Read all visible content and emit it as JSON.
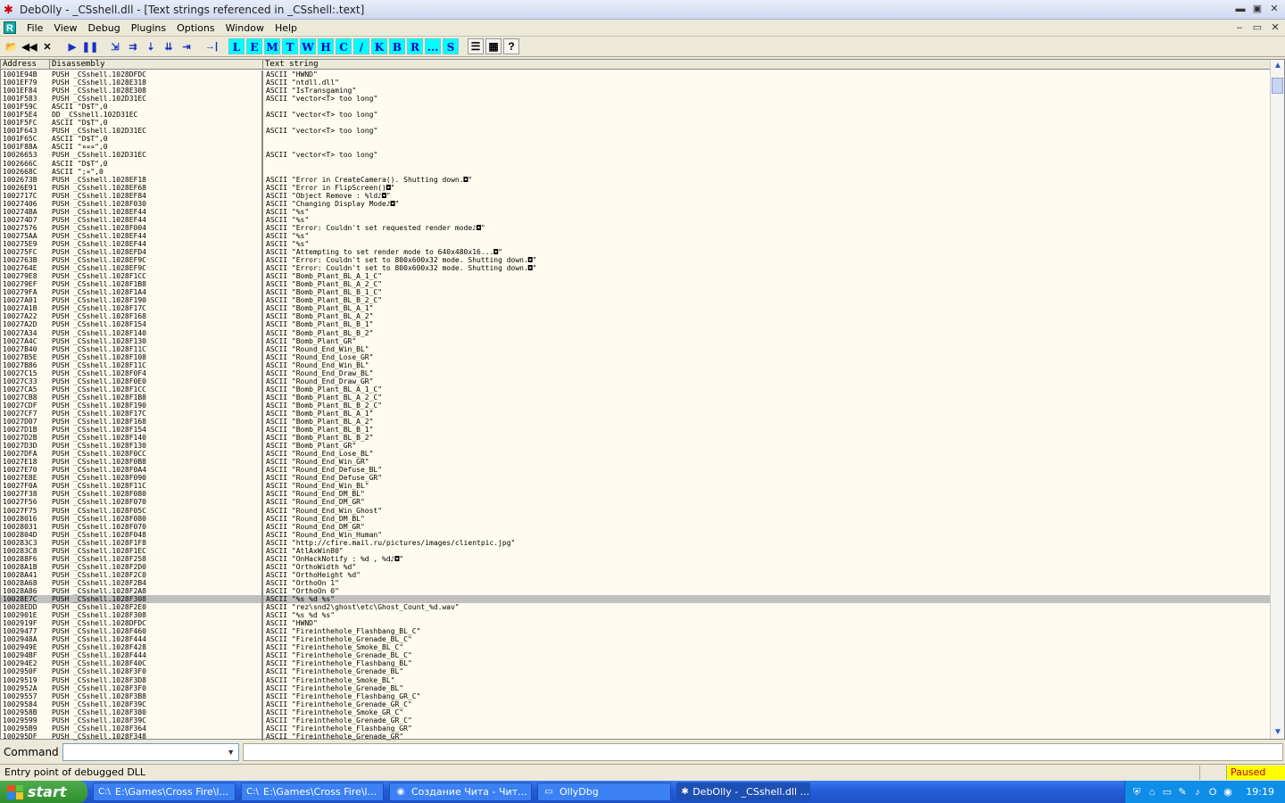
{
  "window": {
    "title": "DebOlly - _CSshell.dll - [Text strings referenced in _CSshell:.text]",
    "controls": [
      "▬",
      "▣",
      "✕"
    ]
  },
  "menu": {
    "logo": "R",
    "items": [
      "File",
      "View",
      "Debug",
      "Plugins",
      "Options",
      "Window",
      "Help"
    ],
    "mdi_controls": [
      "–",
      "▭",
      "✕"
    ]
  },
  "toolbar": {
    "buttons": [
      {
        "icon": "open-icon",
        "glyph": "📂"
      },
      {
        "icon": "rewind-icon",
        "glyph": "◀◀"
      },
      {
        "icon": "close-icon",
        "glyph": "✕"
      },
      {
        "icon": "run-icon",
        "glyph": "▶"
      },
      {
        "icon": "pause-icon",
        "glyph": "❚❚"
      },
      {
        "icon": "step-into-icon",
        "glyph": "⇲"
      },
      {
        "icon": "step-over-icon",
        "glyph": "⇉"
      },
      {
        "icon": "trace-into-icon",
        "glyph": "⇣"
      },
      {
        "icon": "trace-over-icon",
        "glyph": "⇊"
      },
      {
        "icon": "execute-till-return-icon",
        "glyph": "⇥"
      },
      {
        "icon": "goto-icon",
        "glyph": "→|"
      }
    ],
    "letters": [
      "L",
      "E",
      "M",
      "T",
      "W",
      "H",
      "C",
      "/",
      "K",
      "B",
      "R",
      "...",
      "S"
    ],
    "extras": [
      {
        "icon": "list-icon",
        "glyph": "☰"
      },
      {
        "icon": "grid-icon",
        "glyph": "▦"
      },
      {
        "icon": "help-icon",
        "glyph": "?"
      }
    ]
  },
  "grid": {
    "headers": [
      "Address",
      "Disassembly",
      "Text string"
    ],
    "selected_index": 65,
    "rows": [
      [
        "1001E94B",
        "PUSH _CSshell.1028DFDC",
        "ASCII \"HWND\""
      ],
      [
        "1001EF79",
        "PUSH _CSshell.1028E318",
        "ASCII \"ntdll.dll\""
      ],
      [
        "1001EF84",
        "PUSH _CSshell.1028E308",
        "ASCII \"IsTransgaming\""
      ],
      [
        "1001F583",
        "PUSH _CSshell.102D31EC",
        "ASCII \"vector<T> too long\""
      ],
      [
        "1001F59C",
        "ASCII \"D$T\",0",
        ""
      ],
      [
        "1001F5E4",
        "DD _CSshell.102D31EC",
        "ASCII \"vector<T> too long\""
      ],
      [
        "1001F5FC",
        "ASCII \"D$T\",0",
        ""
      ],
      [
        "1001F643",
        "PUSH _CSshell.102D31EC",
        "ASCII \"vector<T> too long\""
      ],
      [
        "1001F65C",
        "ASCII \"D$T\",0",
        ""
      ],
      [
        "1001F88A",
        "ASCII \"¤¤¤\",0",
        ""
      ],
      [
        "10026653",
        "PUSH _CSshell.102D31EC",
        "ASCII \"vector<T> too long\""
      ],
      [
        "1002666C",
        "ASCII \"D$T\",0",
        ""
      ],
      [
        "1002668C",
        "ASCII \";¤\",0",
        ""
      ],
      [
        "1002673B",
        "PUSH _CSshell.1028EF18",
        "ASCII \"Error in CreateCamera(). Shutting down.◘\""
      ],
      [
        "10026E91",
        "PUSH _CSshell.1028EF68",
        "ASCII \"Error in FlipScreen()◘\""
      ],
      [
        "1002717C",
        "PUSH _CSshell.1028EF84",
        "ASCII \"Object Remove : %ld♪◘\""
      ],
      [
        "10027406",
        "PUSH _CSshell.1028F030",
        "ASCII \"Changing Display Mode♪◘\""
      ],
      [
        "100274BA",
        "PUSH _CSshell.1028EF44",
        "ASCII \"%s\""
      ],
      [
        "100274D7",
        "PUSH _CSshell.1028EF44",
        "ASCII \"%s\""
      ],
      [
        "10027576",
        "PUSH _CSshell.1028F004",
        "ASCII \"Error: Couldn't set requested render mode♪◘\""
      ],
      [
        "100275AA",
        "PUSH _CSshell.1028EF44",
        "ASCII \"%s\""
      ],
      [
        "100275E9",
        "PUSH _CSshell.1028EF44",
        "ASCII \"%s\""
      ],
      [
        "100275FC",
        "PUSH _CSshell.1028EFD4",
        "ASCII \"Attempting to set render mode to 640x480x16...◘\""
      ],
      [
        "1002763B",
        "PUSH _CSshell.1028EF9C",
        "ASCII \"Error: Couldn't set to 800x600x32 mode. Shutting down.◘\""
      ],
      [
        "1002764E",
        "PUSH _CSshell.1028EF9C",
        "ASCII \"Error: Couldn't set to 800x600x32 mode. Shutting down.◘\""
      ],
      [
        "100279E8",
        "PUSH _CSshell.1028F1CC",
        "ASCII \"Bomb_Plant_BL_A_1_C\""
      ],
      [
        "100279EF",
        "PUSH _CSshell.1028F1B8",
        "ASCII \"Bomb_Plant_BL_A_2_C\""
      ],
      [
        "100279FA",
        "PUSH _CSshell.1028F1A4",
        "ASCII \"Bomb_Plant_BL_B_1_C\""
      ],
      [
        "10027A01",
        "PUSH _CSshell.1028F190",
        "ASCII \"Bomb_Plant_BL_B_2_C\""
      ],
      [
        "10027A1B",
        "PUSH _CSshell.1028F17C",
        "ASCII \"Bomb_Plant_BL_A_1\""
      ],
      [
        "10027A22",
        "PUSH _CSshell.1028F168",
        "ASCII \"Bomb_Plant_BL_A_2\""
      ],
      [
        "10027A2D",
        "PUSH _CSshell.1028F154",
        "ASCII \"Bomb_Plant_BL_B_1\""
      ],
      [
        "10027A34",
        "PUSH _CSshell.1028F140",
        "ASCII \"Bomb_Plant_BL_B_2\""
      ],
      [
        "10027A4C",
        "PUSH _CSshell.1028F130",
        "ASCII \"Bomb_Plant_GR\""
      ],
      [
        "10027B40",
        "PUSH _CSshell.1028F11C",
        "ASCII \"Round_End_Win_BL\""
      ],
      [
        "10027B5E",
        "PUSH _CSshell.1028F108",
        "ASCII \"Round_End_Lose_GR\""
      ],
      [
        "10027B86",
        "PUSH _CSshell.1028F11C",
        "ASCII \"Round_End_Win_BL\""
      ],
      [
        "10027C15",
        "PUSH _CSshell.1028F0F4",
        "ASCII \"Round_End_Draw_BL\""
      ],
      [
        "10027C33",
        "PUSH _CSshell.1028F0E0",
        "ASCII \"Round_End_Draw_GR\""
      ],
      [
        "10027CA5",
        "PUSH _CSshell.1028F1CC",
        "ASCII \"Bomb_Plant_BL_A_1_C\""
      ],
      [
        "10027CB8",
        "PUSH _CSshell.1028F1B8",
        "ASCII \"Bomb_Plant_BL_A_2_C\""
      ],
      [
        "10027CDF",
        "PUSH _CSshell.1028F190",
        "ASCII \"Bomb_Plant_BL_B_2_C\""
      ],
      [
        "10027CF7",
        "PUSH _CSshell.1028F17C",
        "ASCII \"Bomb_Plant_BL_A_1\""
      ],
      [
        "10027D07",
        "PUSH _CSshell.1028F168",
        "ASCII \"Bomb_Plant_BL_A_2\""
      ],
      [
        "10027D1B",
        "PUSH _CSshell.1028F154",
        "ASCII \"Bomb_Plant_BL_B_1\""
      ],
      [
        "10027D2B",
        "PUSH _CSshell.1028F140",
        "ASCII \"Bomb_Plant_BL_B_2\""
      ],
      [
        "10027D3D",
        "PUSH _CSshell.1028F130",
        "ASCII \"Bomb_Plant_GR\""
      ],
      [
        "10027DFA",
        "PUSH _CSshell.1028F0CC",
        "ASCII \"Round_End_Lose_BL\""
      ],
      [
        "10027E18",
        "PUSH _CSshell.1028F0B8",
        "ASCII \"Round_End_Win_GR\""
      ],
      [
        "10027E70",
        "PUSH _CSshell.1028F0A4",
        "ASCII \"Round_End_Defuse_BL\""
      ],
      [
        "10027E8E",
        "PUSH _CSshell.1028F090",
        "ASCII \"Round_End_Defuse_GR\""
      ],
      [
        "10027F0A",
        "PUSH _CSshell.1028F11C",
        "ASCII \"Round_End_Win_BL\""
      ],
      [
        "10027F38",
        "PUSH _CSshell.1028F080",
        "ASCII \"Round_End_DM_BL\""
      ],
      [
        "10027F56",
        "PUSH _CSshell.1028F070",
        "ASCII \"Round_End_DM_GR\""
      ],
      [
        "10027F75",
        "PUSH _CSshell.1028F05C",
        "ASCII \"Round_End_Win_Ghost\""
      ],
      [
        "10028016",
        "PUSH _CSshell.1028F080",
        "ASCII \"Round_End_DM_BL\""
      ],
      [
        "10028031",
        "PUSH _CSshell.1028F070",
        "ASCII \"Round_End_DM_GR\""
      ],
      [
        "1002804D",
        "PUSH _CSshell.1028F048",
        "ASCII \"Round_End_Win_Human\""
      ],
      [
        "100283C3",
        "PUSH _CSshell.1028F1F8",
        "ASCII \"http://cfire.mail.ru/pictures/images/clientpic.jpg\""
      ],
      [
        "100283C8",
        "PUSH _CSshell.1028F1EC",
        "ASCII \"AtlAxWin80\""
      ],
      [
        "100288F6",
        "PUSH _CSshell.1028F258",
        "ASCII \"OnHackNotify : %d , %d♪◘\""
      ],
      [
        "10028A1B",
        "PUSH _CSshell.1028F2D0",
        "ASCII \"OrthoWidth %d\""
      ],
      [
        "10028A41",
        "PUSH _CSshell.1028F2C0",
        "ASCII \"OrthoHeight %d\""
      ],
      [
        "10028A68",
        "PUSH _CSshell.1028F2B4",
        "ASCII \"OrthoOn 1\""
      ],
      [
        "10028A86",
        "PUSH _CSshell.1028F2A8",
        "ASCII \"OrthoOn 0\""
      ],
      [
        "10028E7C",
        "PUSH _CSshell.1028F308",
        "ASCII \"%s %d %s\""
      ],
      [
        "10028EDD",
        "PUSH _CSshell.1028F2E0",
        "ASCII \"rez\\snd2\\ghost\\etc\\Ghost_Count_%d.wav\""
      ],
      [
        "1002901E",
        "PUSH _CSshell.1028F308",
        "ASCII \"%s %d %s\""
      ],
      [
        "1002919F",
        "PUSH _CSshell.1028DFDC",
        "ASCII \"HWND\""
      ],
      [
        "10029477",
        "PUSH _CSshell.1028F460",
        "ASCII \"Fireinthehole_Flashbang_BL_C\""
      ],
      [
        "1002948A",
        "PUSH _CSshell.1028F444",
        "ASCII \"Fireinthehole_Grenade_BL_C\""
      ],
      [
        "1002949E",
        "PUSH _CSshell.1028F428",
        "ASCII \"Fireinthehole_Smoke_BL_C\""
      ],
      [
        "100294BF",
        "PUSH _CSshell.1028F444",
        "ASCII \"Fireinthehole_Grenade_BL_C\""
      ],
      [
        "100294E2",
        "PUSH _CSshell.1028F40C",
        "ASCII \"Fireinthehole_Flashbang_BL\""
      ],
      [
        "1002950F",
        "PUSH _CSshell.1028F3F0",
        "ASCII \"Fireinthehole_Grenade_BL\""
      ],
      [
        "10029519",
        "PUSH _CSshell.1028F3D8",
        "ASCII \"Fireinthehole_Smoke_BL\""
      ],
      [
        "1002952A",
        "PUSH _CSshell.1028F3F0",
        "ASCII \"Fireinthehole_Grenade_BL\""
      ],
      [
        "10029557",
        "PUSH _CSshell.1028F3B8",
        "ASCII \"Fireinthehole_Flashbang_GR_C\""
      ],
      [
        "10029584",
        "PUSH _CSshell.1028F39C",
        "ASCII \"Fireinthehole_Grenade_GR_C\""
      ],
      [
        "1002958B",
        "PUSH _CSshell.1028F380",
        "ASCII \"Fireinthehole_Smoke_GR_C\""
      ],
      [
        "10029599",
        "PUSH _CSshell.1028F39C",
        "ASCII \"Fireinthehole_Grenade_GR_C\""
      ],
      [
        "100295B9",
        "PUSH _CSshell.1028F364",
        "ASCII \"Fireinthehole_Flashbang_GR\""
      ],
      [
        "100295DF",
        "PUSH _CSshell.1028F348",
        "ASCII \"Fireinthehole_Grenade_GR\""
      ]
    ]
  },
  "command": {
    "label": "Command",
    "value": ""
  },
  "status": {
    "text": "Entry point of debugged DLL",
    "state": "Paused",
    "state_bg": "#ffff00",
    "state_fg": "#c00000"
  },
  "taskbar": {
    "start_label": "start",
    "tasks": [
      {
        "icon": "cmd-icon",
        "glyph": "C:\\",
        "label": "E:\\Games\\Cross Fire\\l...",
        "active": false
      },
      {
        "icon": "cmd-icon",
        "glyph": "C:\\",
        "label": "E:\\Games\\Cross Fire\\l...",
        "active": false
      },
      {
        "icon": "firefox-icon",
        "glyph": "◉",
        "label": "Создание Чита - Чит...",
        "active": false
      },
      {
        "icon": "folder-icon",
        "glyph": "▭",
        "label": "OllyDbg",
        "active": false
      },
      {
        "icon": "bug-icon",
        "glyph": "✱",
        "label": "DebOlly - _CSshell.dll ...",
        "active": true
      }
    ],
    "tray_icons": [
      "shield-icon",
      "network-icon",
      "monitor-icon",
      "tools-icon",
      "volume-icon",
      "opera-icon",
      "antivirus-icon"
    ],
    "clock": "19:19"
  }
}
